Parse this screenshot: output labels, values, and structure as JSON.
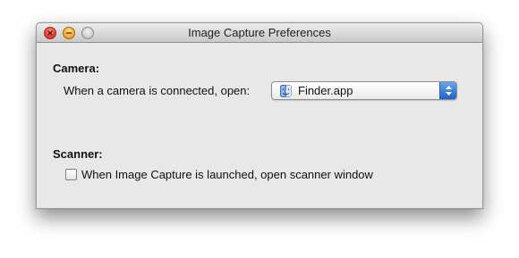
{
  "window": {
    "title": "Image Capture Preferences"
  },
  "camera": {
    "section_label": "Camera:",
    "connect_label": "When a camera is connected, open:",
    "app_selected": "Finder.app",
    "app_icon": "finder-icon"
  },
  "scanner": {
    "section_label": "Scanner:",
    "checkbox_label": "When Image Capture is launched, open scanner window",
    "checkbox_checked": false
  },
  "colors": {
    "window_bg": "#e8e8e8",
    "popup_arrow_blue": "#1f61cc"
  }
}
